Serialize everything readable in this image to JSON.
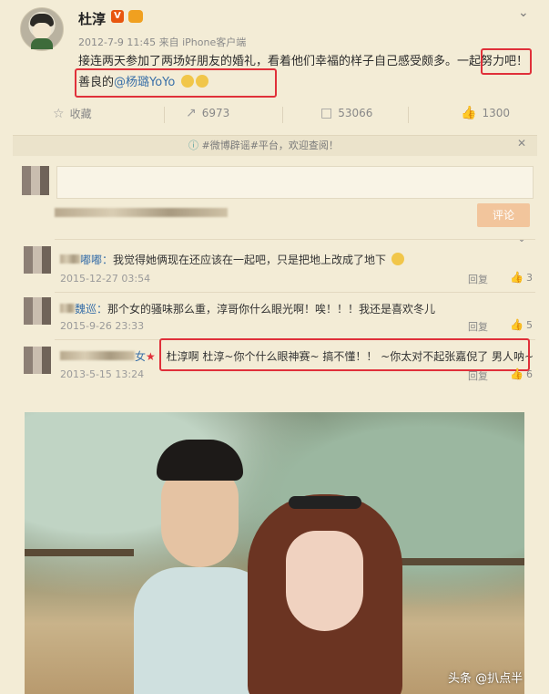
{
  "post": {
    "username": "杜淳",
    "vip_badge": "V",
    "timestamp": "2012-7-9 11:45 来自 iPhone客户端",
    "text_before_mention": "接连两天参加了两场好朋友的婚礼，看着他们幸福的样子自己感受颇多。一起努力吧！善良的",
    "mention": "@杨璐YoYo",
    "highlight_color": "#e0303a"
  },
  "actions": {
    "favorite": {
      "icon": "star-outline-icon",
      "label": "收藏"
    },
    "repost": {
      "icon": "repost-icon",
      "count": "6973"
    },
    "comment": {
      "icon": "comment-icon",
      "count": "53066"
    },
    "like": {
      "icon": "thumbs-up-icon",
      "count": "1300"
    }
  },
  "notice": {
    "text": "#微博辟谣#平台，欢迎查阅！"
  },
  "comment_box": {
    "submit_label": "评论"
  },
  "comments": [
    {
      "name": "嘟嘟：",
      "text": "我觉得她俩现在还应该在一起吧，只是把地上改成了地下",
      "date": "2015-12-27 03:54",
      "reply": "回复",
      "likes": "3"
    },
    {
      "name": "魏巡：",
      "text": "那个女的骚味那么重，淳哥你什么眼光啊！唉！！！我还是喜欢冬儿",
      "date": "2015-9-26 23:33",
      "reply": "回复",
      "likes": "5"
    },
    {
      "name": "女",
      "text": "杜淳啊 杜淳~你个什么眼神赛~ 搞不懂！！ ~你太对不起张嘉倪了 男人呐~",
      "date": "2013-5-15 13:24",
      "reply": "回复",
      "likes": "6"
    }
  ],
  "watermark": "头条 @扒点半"
}
